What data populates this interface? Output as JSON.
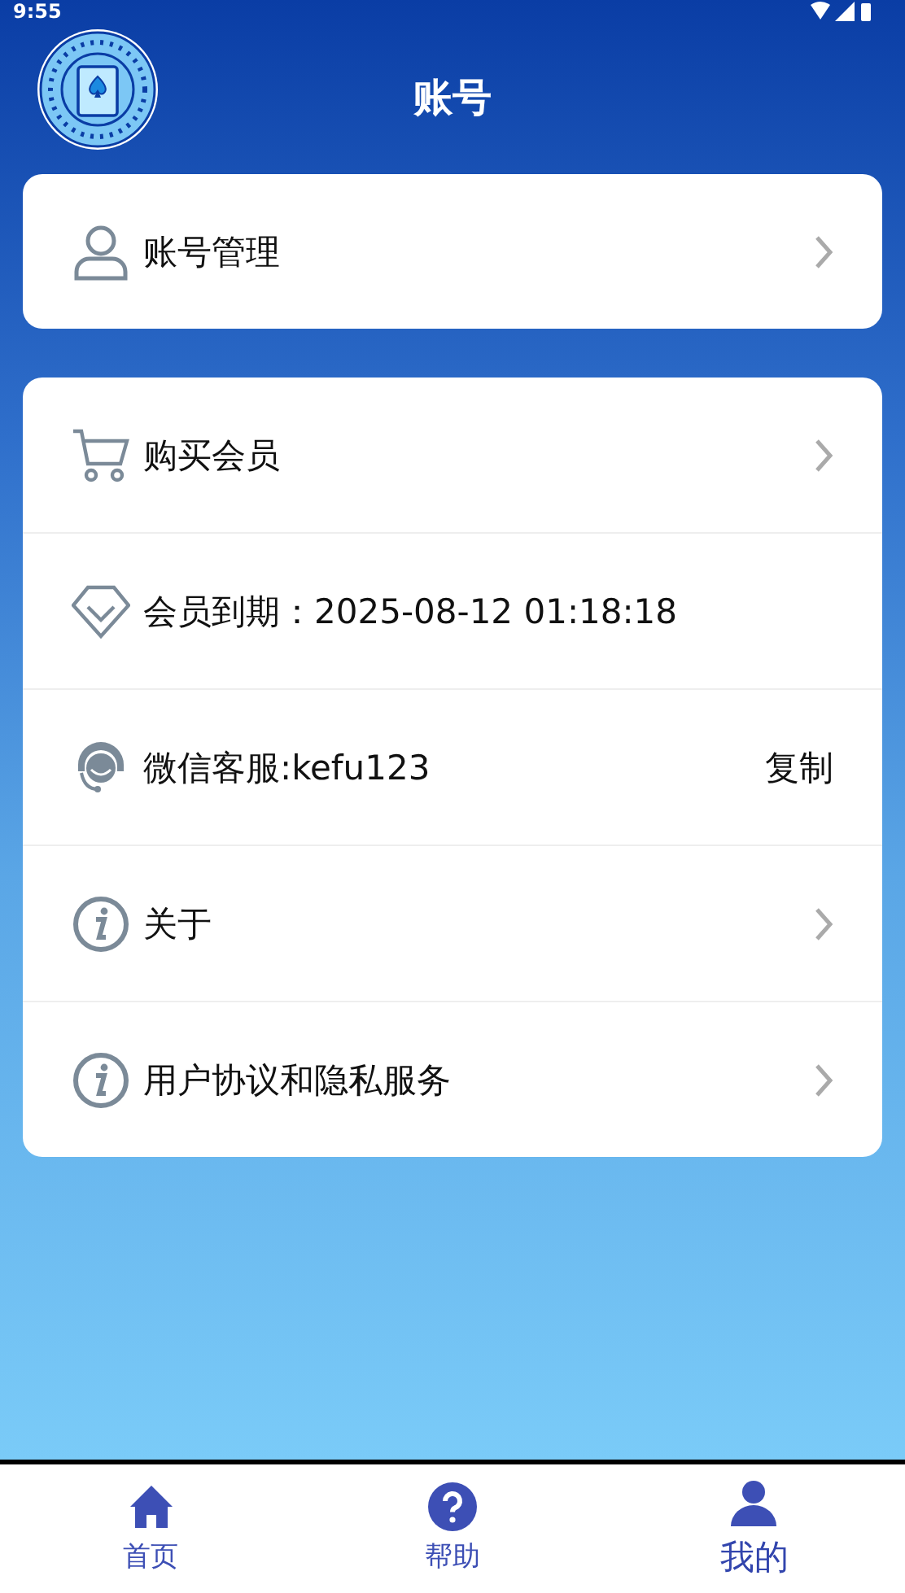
{
  "status_bar": {
    "time": "9:55"
  },
  "header": {
    "title": "账号"
  },
  "cards": [
    {
      "rows": [
        {
          "label": "账号管理",
          "kind": "chevron"
        }
      ]
    },
    {
      "rows": [
        {
          "label": "购买会员",
          "kind": "chevron"
        },
        {
          "label": "会员到期：2025-08-12 01:18:18",
          "kind": "plain"
        },
        {
          "label": "微信客服:kefu123",
          "kind": "action",
          "action": "复制"
        },
        {
          "label": "关于",
          "kind": "chevron"
        },
        {
          "label": "用户协议和隐私服务",
          "kind": "chevron"
        }
      ]
    }
  ],
  "tabs": [
    {
      "label": "首页",
      "selected": false
    },
    {
      "label": "帮助",
      "selected": false
    },
    {
      "label": "我的",
      "selected": true
    }
  ]
}
